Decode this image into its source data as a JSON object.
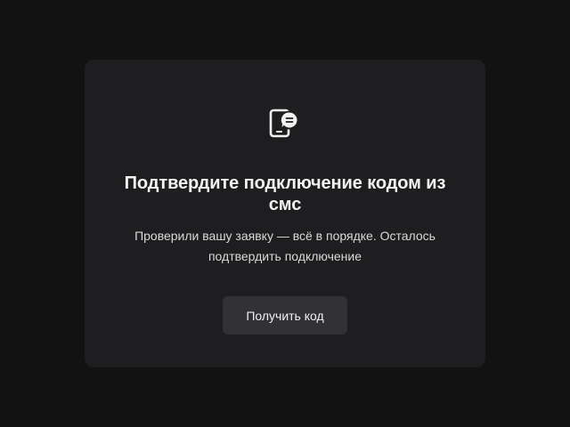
{
  "dialog": {
    "icon": "phone-sms-icon",
    "title": "Подтвердите подключение кодом из смс",
    "message": "Проверили вашу заявку — всё в порядке. Осталось подтвердить подключение",
    "button_label": "Получить код"
  },
  "colors": {
    "background": "#121212",
    "card": "#1e1e20",
    "button": "#323236",
    "text": "#f2f2f2"
  }
}
